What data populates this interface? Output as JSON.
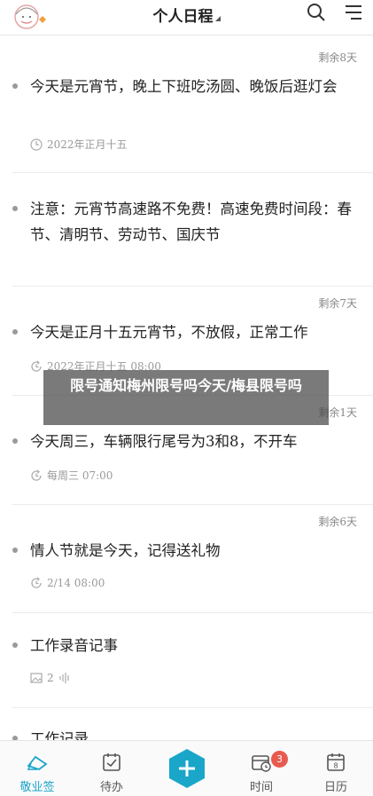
{
  "header": {
    "title": "个人日程",
    "avatar_icon": "girl-avatar-icon",
    "search_icon": "search-icon",
    "menu_icon": "menu-icon"
  },
  "items": [
    {
      "remaining": "剩余8天",
      "text": "今天是元宵节，晚上下班吃汤圆、晚饭后逛灯会",
      "meta": "2022年正月十五",
      "meta_icon": "clock-icon"
    },
    {
      "remaining": "",
      "text": "注意：元宵节高速路不免费！高速免费时间段：春节、清明节、劳动节、国庆节",
      "meta": "",
      "meta_icon": ""
    },
    {
      "remaining": "剩余7天",
      "text": "今天是正月十五元宵节，不放假，正常工作",
      "meta": "2022年正月十五 08:00",
      "meta_icon": "repeat-clock-icon"
    },
    {
      "remaining": "剩余1天",
      "text": "今天周三，车辆限行尾号为3和8，不开车",
      "meta": "每周三 07:00",
      "meta_icon": "repeat-clock-icon"
    },
    {
      "remaining": "剩余6天",
      "text": "情人节就是今天，记得送礼物",
      "meta": "2/14 08:00",
      "meta_icon": "repeat-clock-icon"
    },
    {
      "remaining": "",
      "text": "工作录音记事",
      "meta": "2",
      "meta_icon": "image-icon"
    },
    {
      "remaining": "",
      "text": "工作记录",
      "meta": "",
      "meta_icon": ""
    }
  ],
  "overlay": {
    "text": "限号通知梅州限号吗今天/梅县限号吗"
  },
  "tabbar": {
    "tabs": [
      {
        "label": "敬业签",
        "icon": "home-icon",
        "active": true
      },
      {
        "label": "待办",
        "icon": "todo-check-icon",
        "active": false
      },
      {
        "label": "时间",
        "icon": "calendar-clock-icon",
        "active": false
      },
      {
        "label": "日历",
        "icon": "calendar-icon",
        "active": false
      }
    ],
    "add_icon": "plus-icon",
    "time_badge": "3"
  },
  "colors": {
    "accent": "#1aa6c9",
    "badge": "#e85a4f"
  }
}
